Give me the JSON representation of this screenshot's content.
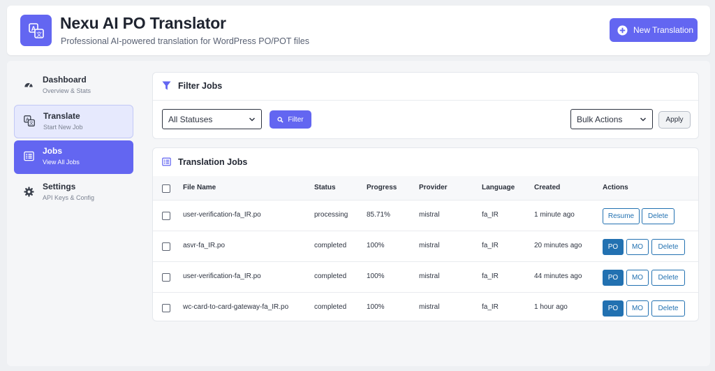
{
  "header": {
    "title": "Nexu AI PO Translator",
    "subtitle": "Professional AI-powered translation for WordPress PO/POT files",
    "new_button": "New Translation"
  },
  "sidebar": {
    "items": [
      {
        "label": "Dashboard",
        "sub": "Overview & Stats",
        "icon": "gauge-icon"
      },
      {
        "label": "Translate",
        "sub": "Start New Job",
        "icon": "translate-icon"
      },
      {
        "label": "Jobs",
        "sub": "View All Jobs",
        "icon": "list-icon"
      },
      {
        "label": "Settings",
        "sub": "API Keys & Config",
        "icon": "gear-icon"
      }
    ]
  },
  "filter": {
    "title": "Filter Jobs",
    "status_select": "All Statuses",
    "filter_button": "Filter",
    "bulk_select": "Bulk Actions",
    "apply_button": "Apply"
  },
  "jobs": {
    "title": "Translation Jobs",
    "columns": [
      "File Name",
      "Status",
      "Progress",
      "Provider",
      "Language",
      "Created",
      "Actions"
    ],
    "rows": [
      {
        "file": "user-verification-fa_IR.po",
        "status": "processing",
        "progress": "85.71%",
        "provider": "mistral",
        "language": "fa_IR",
        "created": "1 minute ago",
        "actions": [
          "Resume",
          "Delete"
        ]
      },
      {
        "file": "asvr-fa_IR.po",
        "status": "completed",
        "progress": "100%",
        "provider": "mistral",
        "language": "fa_IR",
        "created": "20 minutes ago",
        "actions": [
          "PO",
          "MO",
          "Delete"
        ]
      },
      {
        "file": "user-verification-fa_IR.po",
        "status": "completed",
        "progress": "100%",
        "provider": "mistral",
        "language": "fa_IR",
        "created": "44 minutes ago",
        "actions": [
          "PO",
          "MO",
          "Delete"
        ]
      },
      {
        "file": "wc-card-to-card-gateway-fa_IR.po",
        "status": "completed",
        "progress": "100%",
        "provider": "mistral",
        "language": "fa_IR",
        "created": "1 hour ago",
        "actions": [
          "PO",
          "MO",
          "Delete"
        ]
      }
    ]
  },
  "colors": {
    "accent": "#6366f1",
    "wp_blue": "#2271b1"
  }
}
